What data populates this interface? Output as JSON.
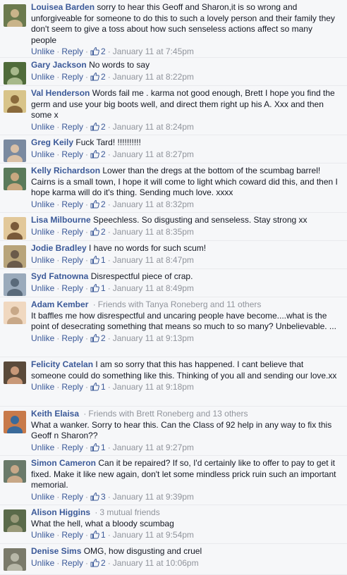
{
  "actions": {
    "unlike_label": "Unlike",
    "reply_label": "Reply",
    "separator": "·"
  },
  "colors": {
    "link": "#3b5998",
    "meta": "#90949c",
    "text": "#141823",
    "background": "#f6f7f9"
  },
  "comments": [
    {
      "author": "Louisea Barden",
      "friends_note": "",
      "text": "sorry to hear this Geoff and Sharon,it is so wrong and unforgiveable for someone to do this to such a lovely person and their family they don't seem to give a toss about how such senseless actions affect so many people",
      "likes": "2",
      "time": "January 11 at 7:45pm"
    },
    {
      "author": "Gary Jackson",
      "friends_note": "",
      "text": "No words to say",
      "likes": "2",
      "time": "January 11 at 8:22pm"
    },
    {
      "author": "Val Henderson",
      "friends_note": "",
      "text": "Words fail me . karma not good enough, Brett I hope you find the germ and use your big boots well, and direct them right up his A. Xxx and then some x",
      "likes": "2",
      "time": "January 11 at 8:24pm"
    },
    {
      "author": "Greg Keily",
      "friends_note": "",
      "text": "Fuck Tard! !!!!!!!!!!",
      "likes": "2",
      "time": "January 11 at 8:27pm"
    },
    {
      "author": "Kelly Richardson",
      "friends_note": "",
      "text": "Lower than the dregs at the bottom of the scumbag barrel! Cairns is a small town, I hope it will come to light which coward did this, and then I hope karma will do it's thing. Sending much love. xxxx",
      "likes": "2",
      "time": "January 11 at 8:32pm"
    },
    {
      "author": "Lisa Milbourne",
      "friends_note": "",
      "text": "Speechless. So disgusting and senseless. Stay strong xx",
      "likes": "2",
      "time": "January 11 at 8:35pm"
    },
    {
      "author": "Jodie Bradley",
      "friends_note": "",
      "text": "I have no words for such scum!",
      "likes": "1",
      "time": "January 11 at 8:47pm"
    },
    {
      "author": "Syd Fatnowna",
      "friends_note": "",
      "text": "Disrespectful piece of crap.",
      "likes": "1",
      "time": "January 11 at 8:49pm"
    },
    {
      "author": "Adam Kember",
      "friends_note": "Friends with Tanya Roneberg and 11 others",
      "text": "It baffles me how disrespectful and uncaring people have become....what is the point of desecrating something that means so much to so many? Unbelievable. ...",
      "likes": "2",
      "time": "January 11 at 9:13pm"
    },
    {
      "author": "Felicity Catelan",
      "friends_note": "",
      "text": "I am so sorry that this has happened. I cant believe that someone could do something like this. Thinking of you all and sending our love.xx",
      "likes": "1",
      "time": "January 11 at 9:18pm"
    },
    {
      "author": "Keith Elaisa",
      "friends_note": "Friends with Brett Roneberg and 13 others",
      "text": "What a wanker. Sorry to hear this. Can the Class of 92 help in any way to fix this Geoff n Sharon??",
      "likes": "1",
      "time": "January 11 at 9:27pm"
    },
    {
      "author": "Simon Cameron",
      "friends_note": "",
      "text": "Can it be repaired? If so, I'd certainly like to offer to pay to get it fixed. Make it like new again, don't let some mindless prick ruin such an important memorial.",
      "likes": "3",
      "time": "January 11 at 9:39pm"
    },
    {
      "author": "Alison Higgins",
      "friends_note": "3 mutual friends",
      "text": "What the hell, what a bloody scumbag",
      "likes": "1",
      "time": "January 11 at 9:54pm"
    },
    {
      "author": "Denise Sims",
      "friends_note": "",
      "text": "OMG, how disgusting and cruel",
      "likes": "2",
      "time": "January 11 at 10:06pm"
    }
  ]
}
